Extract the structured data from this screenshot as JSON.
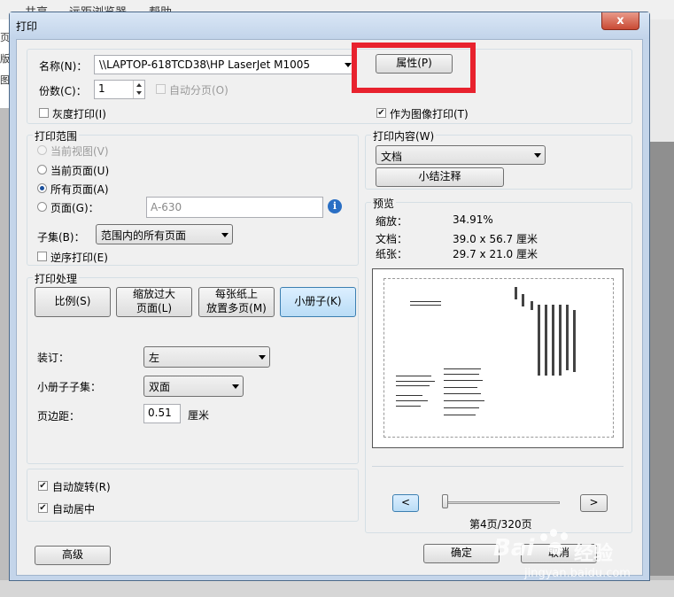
{
  "background": {
    "menu": [
      "共享",
      "远距浏览器",
      "帮助"
    ],
    "left_fragments": [
      "页",
      "版",
      "图"
    ]
  },
  "dialog": {
    "title": "打印",
    "close_glyph": "x"
  },
  "printer": {
    "name_label": "名称(N)：",
    "name_value": "\\\\LAPTOP-618TCD38\\HP LaserJet M1005",
    "properties_button": "属性(P)",
    "copies_label": "份数(C)：",
    "copies_value": "1",
    "collate_label": "自动分页(O)",
    "grayscale_label": "灰度打印(I)",
    "print_as_image_label": "作为图像打印(T)"
  },
  "print_range": {
    "title": "打印范围",
    "current_view": "当前视图(V)",
    "current_page": "当前页面(U)",
    "all_pages": "所有页面(A)",
    "pages": "页面(G)：",
    "pages_placeholder": "A-630",
    "subset_label": "子集(B)：",
    "subset_value": "范围内的所有页面",
    "reverse_label": "逆序打印(E)"
  },
  "print_content": {
    "title": "打印内容(W)",
    "value": "文档",
    "summarize_button": "小结注释"
  },
  "print_handling": {
    "title": "打印处理",
    "scale_button": "比例(S)",
    "shrink_button": [
      "缩放过大",
      "页面(L)"
    ],
    "multiple_button": [
      "每张纸上",
      "放置多页(M)"
    ],
    "booklet_button": "小册子(K)",
    "binding_label": "装订：",
    "binding_value": "左",
    "booklet_subset_label": "小册子子集：",
    "booklet_subset_value": "双面",
    "margin_label": "页边距：",
    "margin_value": "0.51",
    "margin_unit": "厘米"
  },
  "auto": {
    "rotate_label": "自动旋转(R)",
    "center_label": "自动居中"
  },
  "preview": {
    "title": "预览",
    "zoom_label": "缩放：",
    "zoom_value": "34.91%",
    "doc_label": "文档：",
    "doc_value": "39.0 x 56.7 厘米",
    "paper_label": "纸张：",
    "paper_value": "29.7 x 21.0 厘米",
    "prev_button": "<",
    "next_button": ">",
    "page_indicator": "第4页/320页"
  },
  "footer": {
    "advanced_button": "高级",
    "ok_button": "确定",
    "cancel_button": "取消"
  },
  "watermark": {
    "brand": "Bai",
    "brand_cn": "经验",
    "url": "jingyan.baidu.com"
  },
  "colors": {
    "highlight": "#e8222e",
    "dialog_frame": "#c4d5ea",
    "selected_button": "#b9dcf6"
  }
}
